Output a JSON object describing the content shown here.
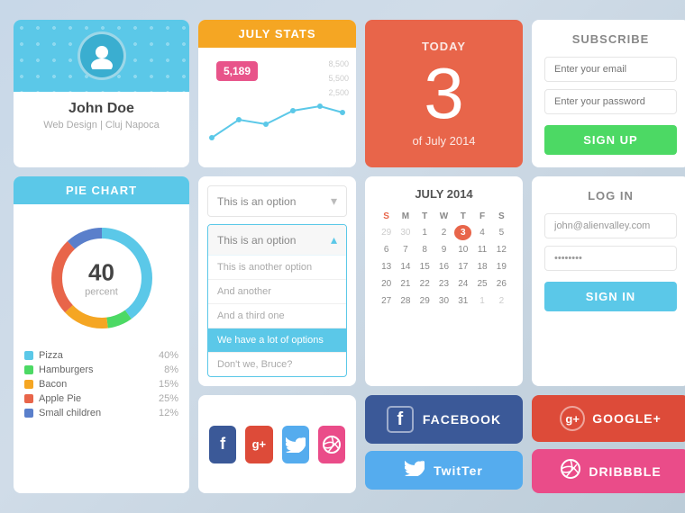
{
  "profile": {
    "name": "John Doe",
    "subtitle": "Web Design | Cluj Napoca"
  },
  "stats": {
    "header": "JULY STATS",
    "badge": "5,189",
    "labels": [
      "8,500",
      "5,500",
      "2,500"
    ]
  },
  "today": {
    "label": "TODAY",
    "number": "3",
    "sub": "of July 2014"
  },
  "subscribe": {
    "title": "SUBSCRIBE",
    "email_placeholder": "Enter your email",
    "password_placeholder": "Enter your password",
    "button": "SIGN UP"
  },
  "pie": {
    "header": "PIE CHART",
    "number": "40",
    "percent_label": "percent",
    "legend": [
      {
        "label": "Pizza",
        "pct": "40%",
        "color": "#5bc8e8"
      },
      {
        "label": "Hamburgers",
        "pct": "8%",
        "color": "#4cd964"
      },
      {
        "label": "Bacon",
        "pct": "15%",
        "color": "#f5a623"
      },
      {
        "label": "Apple Pie",
        "pct": "25%",
        "color": "#e8654a"
      },
      {
        "label": "Small children",
        "pct": "12%",
        "color": "#5a7fcb"
      }
    ]
  },
  "dropdown": {
    "select_label": "This is an option",
    "open_label": "This is an option",
    "options": [
      "This is another option",
      "And another",
      "And a third one",
      "We have a lot of options",
      "Don't we, Bruce?"
    ]
  },
  "calendar": {
    "title": "JULY 2014",
    "days_header": [
      "S",
      "M",
      "T",
      "W",
      "T",
      "F",
      "S"
    ],
    "rows": [
      [
        "29",
        "30",
        "1",
        "2",
        "3",
        "4",
        "5"
      ],
      [
        "6",
        "7",
        "8",
        "9",
        "10",
        "11",
        "12"
      ],
      [
        "13",
        "14",
        "15",
        "16",
        "17",
        "18",
        "19"
      ],
      [
        "20",
        "21",
        "22",
        "23",
        "24",
        "25",
        "26"
      ],
      [
        "27",
        "28",
        "29",
        "30",
        "31",
        "1",
        "2"
      ]
    ],
    "today_day": "3"
  },
  "login": {
    "title": "LOG IN",
    "email_value": "john@alienvalley.com",
    "password_value": "●●●●●●●●",
    "button": "SIGN IN"
  },
  "social_icons": [
    "f",
    "g+",
    "t",
    "d"
  ],
  "social_buttons": {
    "facebook": "FACEBOOK",
    "google": "GOOGLE+",
    "twitter": "TwitTer",
    "dribbble": "DRIBBBLE"
  }
}
